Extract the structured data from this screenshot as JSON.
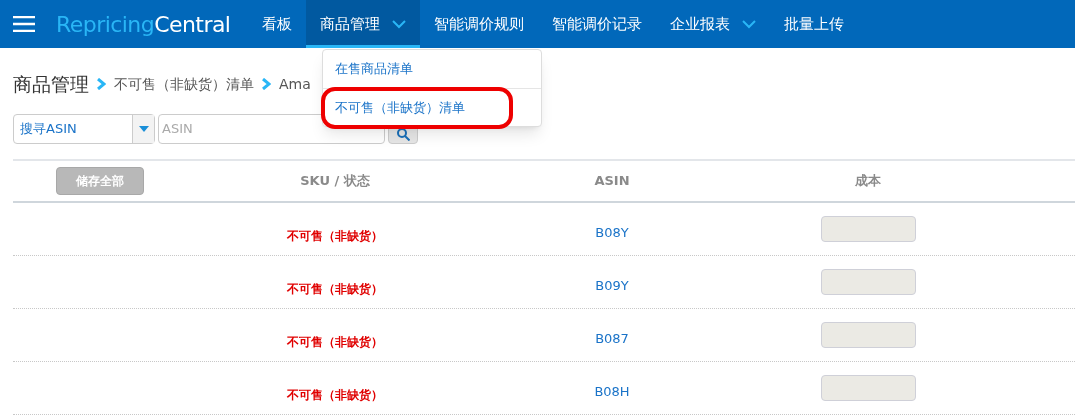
{
  "logo": {
    "part_1": "Repricing",
    "part_2": "Central"
  },
  "nav": [
    {
      "label": "看板",
      "selected": false,
      "has_menu": false
    },
    {
      "label": "商品管理",
      "selected": true,
      "has_menu": true
    },
    {
      "label": "智能调价规则",
      "selected": false,
      "has_menu": false
    },
    {
      "label": "智能调价记录",
      "selected": false,
      "has_menu": false
    },
    {
      "label": "企业报表",
      "selected": false,
      "has_menu": true
    },
    {
      "label": "批量上传",
      "selected": false,
      "has_menu": false
    }
  ],
  "dropdown": [
    {
      "label": "在售商品清单",
      "highlighted": false
    },
    {
      "label": "不可售（非缺货）清单",
      "highlighted": true
    }
  ],
  "breadcrumb": [
    "商品管理",
    "不可售（非缺货）清单",
    "Ama"
  ],
  "search": {
    "type_select": "搜寻ASIN",
    "placeholder": "ASIN"
  },
  "table": {
    "save_all": "储存全部",
    "columns": [
      "SKU / 状态",
      "ASIN",
      "成本"
    ],
    "rows": [
      {
        "status": "不可售（非缺货）",
        "asin": "B08Y"
      },
      {
        "status": "不可售（非缺货）",
        "asin": "B09Y"
      },
      {
        "status": "不可售（非缺货）",
        "asin": "B087"
      },
      {
        "status": "不可售（非缺货）",
        "asin": "B08H"
      }
    ]
  }
}
